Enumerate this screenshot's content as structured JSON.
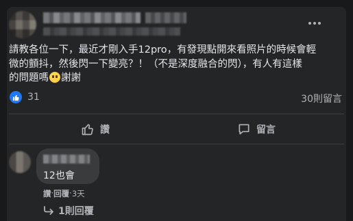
{
  "post": {
    "text_line1": "請教各位一下，最近才剛入手12pro，有發現點開來看照片的時候會輕",
    "text_line2": "微的顫抖，然後閃一下變亮？！（不是深度融合的閃），有人有這樣",
    "text_line3_before": "的問題嗎",
    "text_line3_after": "謝謝",
    "emoji_icon": "crying-face-emoji"
  },
  "reactions": {
    "like_count": "31",
    "comment_count": "30則留言",
    "like_color": "#2078f4"
  },
  "actions": {
    "like_label": "讚",
    "comment_label": "留言"
  },
  "comment": {
    "text": "12也會",
    "like_label": "讚",
    "reply_label": "回覆",
    "separator": "·",
    "time": "3天",
    "replies_label": "1則回覆"
  }
}
